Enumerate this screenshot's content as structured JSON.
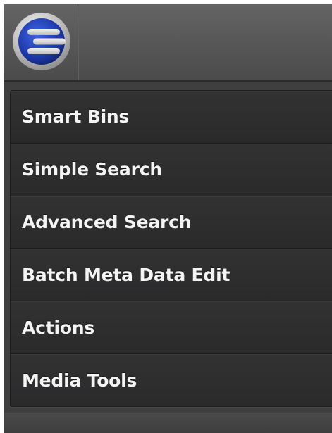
{
  "toolbar": {
    "logo_icon": "blue-circle-stripes-logo-icon",
    "logo_colors": {
      "ring": "#c9c9c9",
      "disc": "#1f3fb0",
      "stripes": "#dcdcdc"
    }
  },
  "menu": {
    "items": [
      {
        "label": "Smart Bins"
      },
      {
        "label": "Simple Search"
      },
      {
        "label": "Advanced Search"
      },
      {
        "label": "Batch Meta Data Edit"
      },
      {
        "label": "Actions"
      },
      {
        "label": "Media Tools"
      }
    ]
  },
  "colors": {
    "background": "#3f3f40",
    "menu_background": "#2c2c2d",
    "menu_text": "#f4f4f4"
  }
}
